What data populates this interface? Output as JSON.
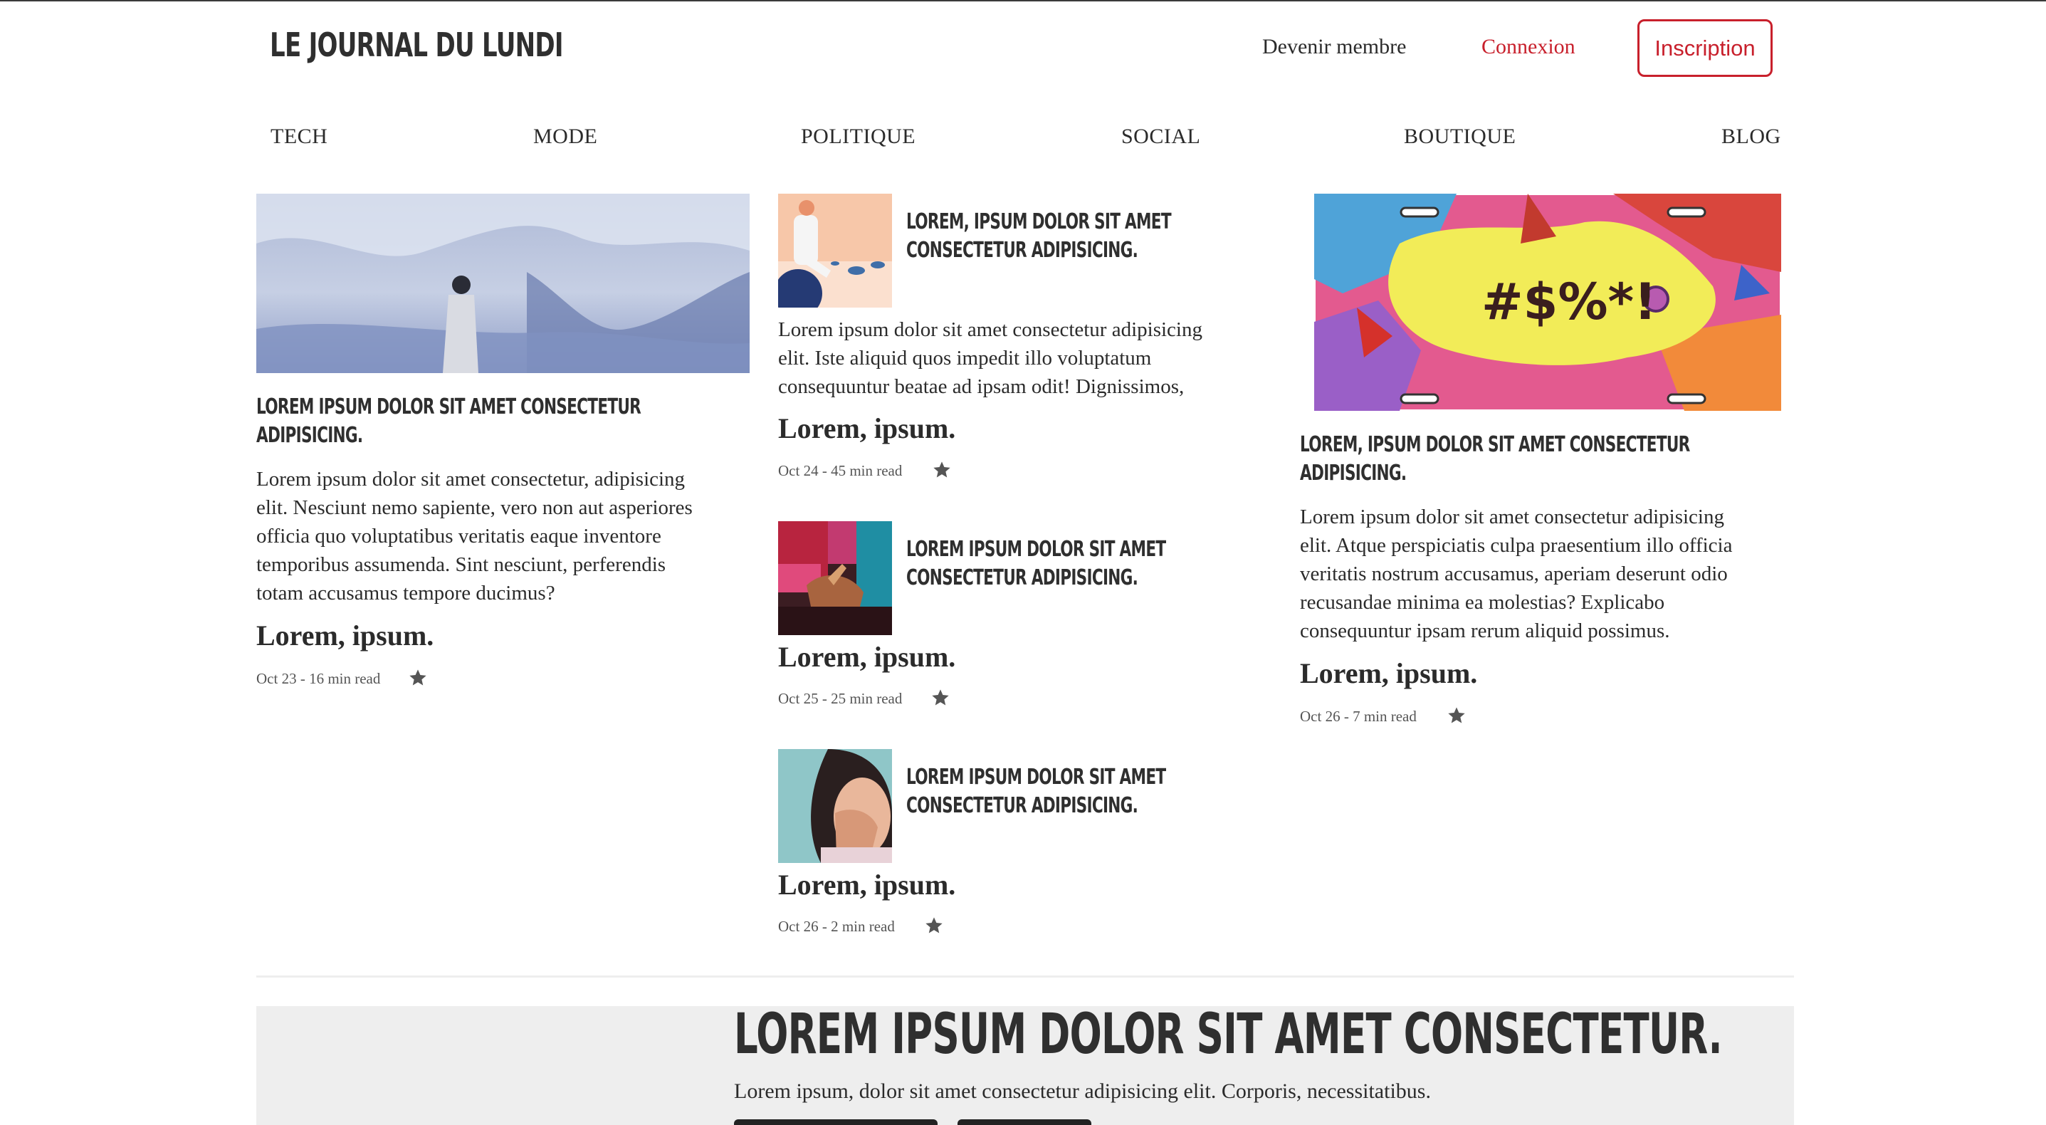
{
  "header": {
    "logo": "LE JOURNAL DU LUNDI",
    "become_member": "Devenir membre",
    "login": "Connexion",
    "signup": "Inscription"
  },
  "nav": {
    "items": [
      "TECH",
      "MODE",
      "POLITIQUE",
      "SOCIAL",
      "BOUTIQUE",
      "BLOG"
    ]
  },
  "articles": {
    "left": {
      "title_line1": "Lorem ipsum dolor sit amet consectetur",
      "title_line2": "adipisicing.",
      "para_lines": [
        "Lorem ipsum dolor sit amet consectetur, adipisicing",
        "elit. Nesciunt nemo sapiente, vero non aut asperiores",
        "officia quo voluptatibus veritatis eaque inventore",
        "temporibus assumenda. Sint nesciunt, perferendis",
        "totam accusamus tempore ducimus?"
      ],
      "lead": "Lorem, ipsum.",
      "meta": "Oct 23 - 16 min read"
    },
    "mid1": {
      "title_line1": "Lorem, ipsum dolor sit amet",
      "title_line2": "consectetur adipisicing.",
      "para_lines": [
        "Lorem ipsum dolor sit amet consectetur adipisicing",
        "elit. Iste aliquid quos impedit illo voluptatum",
        "consequuntur beatae ad ipsam odit! Dignissimos,"
      ],
      "lead": "Lorem, ipsum.",
      "meta": "Oct 24 - 45 min read"
    },
    "mid2": {
      "title_line1": "Lorem ipsum dolor sit amet",
      "title_line2": "consectetur adipisicing.",
      "lead": "Lorem, ipsum.",
      "meta": "Oct 25 - 25 min read"
    },
    "mid3": {
      "title_line1": "Lorem ipsum dolor sit amet",
      "title_line2": "consectetur adipisicing.",
      "lead": "Lorem, ipsum.",
      "meta": "Oct 26 - 2 min read"
    },
    "right": {
      "title_line1": "Lorem, ipsum dolor sit amet consectetur",
      "title_line2": "adipisicing.",
      "para_lines": [
        "Lorem ipsum dolor sit amet consectetur adipisicing",
        "elit. Atque perspiciatis culpa praesentium illo officia",
        "veritatis nostrum accusamus, aperiam deserunt odio",
        "recusandae minima ea molestias? Explicabo",
        "consequuntur ipsam rerum aliquid possimus."
      ],
      "lead": "Lorem, ipsum.",
      "meta": "Oct 26 - 7 min read",
      "plate_text": "#$%*!"
    }
  },
  "promo": {
    "title": "Lorem ipsum dolor sit amet consectetur.",
    "subtitle": "Lorem ipsum, dolor sit amet consectetur adipisicing elit. Corporis, necessitatibus."
  },
  "colors": {
    "accent": "#c8202c",
    "text": "#2b2b2b",
    "promo_bg": "#eeeeee"
  }
}
